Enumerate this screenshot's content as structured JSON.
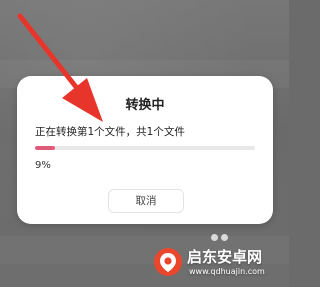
{
  "dialog": {
    "title": "转换中",
    "message": "正在转换第1个文件，共1个文件",
    "progress": 0.09,
    "progress_text": "9%",
    "cancel_label": "取消"
  },
  "colors": {
    "progress_fill": "#e05a7a",
    "arrow": "#e8352b",
    "watermark_logo": "#e9462c"
  },
  "annotation": {
    "icon": "red-arrow-icon"
  },
  "watermark": {
    "brand": "启东安卓网",
    "url": "www.qdhuajin.com",
    "icon": "watermark-logo-icon"
  }
}
